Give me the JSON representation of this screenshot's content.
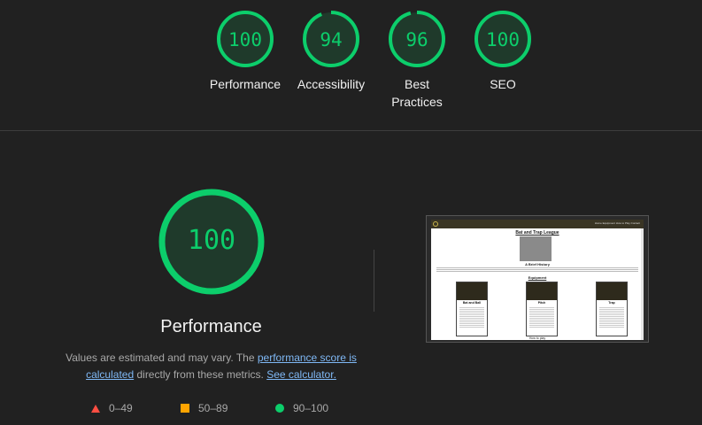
{
  "summary": [
    {
      "score": "100",
      "fraction": 1.0,
      "label": "Performance"
    },
    {
      "score": "94",
      "fraction": 0.94,
      "label": "Accessibility"
    },
    {
      "score": "96",
      "fraction": 0.96,
      "label": "Best Practices"
    },
    {
      "score": "100",
      "fraction": 1.0,
      "label": "SEO"
    }
  ],
  "performance": {
    "score": "100",
    "fraction": 1.0,
    "title": "Performance",
    "note_prefix": "Values are estimated and may vary. The ",
    "link_score": "performance score is calculated",
    "note_middle": " directly from these metrics. ",
    "link_calculator": "See calculator."
  },
  "legend": [
    {
      "range": "0–49",
      "shape": "triangle",
      "color": "#ff4e42"
    },
    {
      "range": "50–89",
      "shape": "square",
      "color": "#ffa400"
    },
    {
      "range": "90–100",
      "shape": "circle",
      "color": "#0cce6b"
    }
  ],
  "screenshot": {
    "site_title": "Bat and Trap League",
    "nav_text": "Home  Equipment  How to Play  Contact",
    "subtitle": "A Brief History",
    "section": "Equipment",
    "cards": [
      "Bat and Ball",
      "Pitch",
      "Trap"
    ],
    "footer": "How to play"
  },
  "colors": {
    "pass": "#0cce6b",
    "pass_bg": "#1f3a2b",
    "background": "#212121"
  }
}
